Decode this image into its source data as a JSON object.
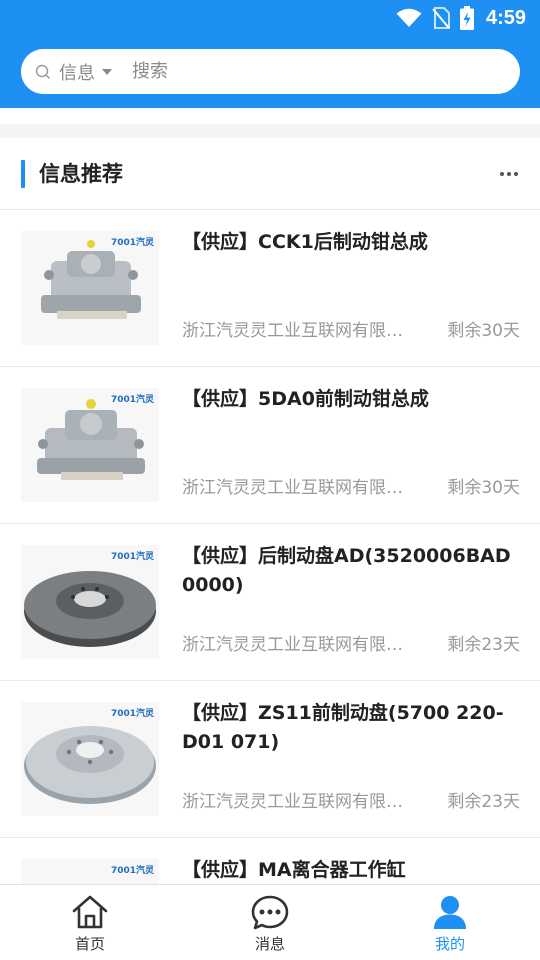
{
  "status_bar": {
    "time": "4:59"
  },
  "search": {
    "scope": "信息",
    "placeholder": "搜索"
  },
  "section": {
    "title": "信息推荐"
  },
  "items": [
    {
      "title": "【供应】CCK1后制动钳总成",
      "company": "浙江汽灵灵工业互联网有限公司",
      "remain": "剩余30天",
      "image": "caliper",
      "watermark": "7001汽灵"
    },
    {
      "title": "【供应】5DA0前制动钳总成",
      "company": "浙江汽灵灵工业互联网有限公司",
      "remain": "剩余30天",
      "image": "caliper",
      "watermark": "7001汽灵"
    },
    {
      "title": "【供应】后制动盘AD(3520006BAD0000)",
      "company": "浙江汽灵灵工业互联网有限公司",
      "remain": "剩余23天",
      "image": "disc-dark",
      "watermark": "7001汽灵"
    },
    {
      "title": "【供应】ZS11前制动盘(5700 220-D01 071)",
      "company": "浙江汽灵灵工业互联网有限公司",
      "remain": "剩余23天",
      "image": "disc-vented",
      "watermark": "7001汽灵"
    },
    {
      "title": "【供应】MA离合器工作缸",
      "company": "",
      "remain": "",
      "image": "cylinder",
      "watermark": "7001汽灵"
    }
  ],
  "tabbar": {
    "tabs": [
      {
        "label": "首页",
        "icon": "home-icon",
        "active": false
      },
      {
        "label": "消息",
        "icon": "message-icon",
        "active": false
      },
      {
        "label": "我的",
        "icon": "user-icon",
        "active": true
      }
    ]
  },
  "colors": {
    "brand": "#1e90f3",
    "text": "#222222",
    "muted": "#999999"
  }
}
